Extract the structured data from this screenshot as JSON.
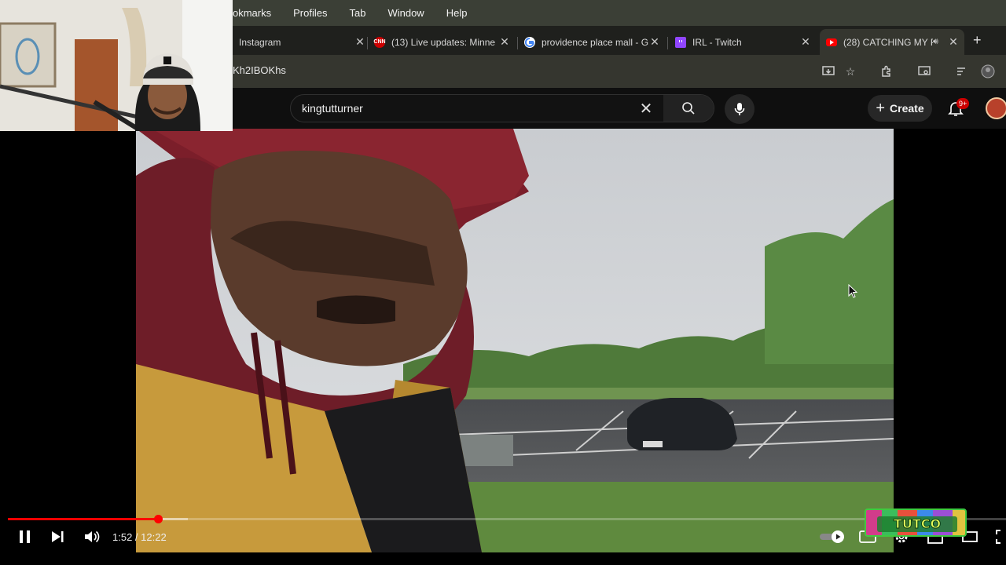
{
  "menubar": {
    "items": [
      "okmarks",
      "Profiles",
      "Tab",
      "Window",
      "Help"
    ]
  },
  "tabs": [
    {
      "title": "Instagram",
      "icon": "instagram-icon"
    },
    {
      "title": "(13) Live updates: Minne",
      "icon": "cnn-icon"
    },
    {
      "title": "providence place mall - G",
      "icon": "google-icon"
    },
    {
      "title": "IRL - Twitch",
      "icon": "twitch-icon"
    },
    {
      "title": "(28) CATCHING MY P",
      "icon": "youtube-icon",
      "active": true
    }
  ],
  "address_bar": {
    "url_fragment": "Kh2IBOKhs"
  },
  "youtube": {
    "search_query": "kingtutturner",
    "create_label": "Create",
    "notification_badge": "9+"
  },
  "player": {
    "current_time": "1:52",
    "duration": "12:22",
    "time_display": "1:52 / 12:22",
    "progress_fraction": 0.151,
    "buffered_fraction": 0.18
  },
  "overlay_logo": {
    "text": "TUTCO"
  },
  "colors": {
    "youtube_red": "#ff0000",
    "background": "#0f0f0f",
    "badge_red": "#cc0000"
  }
}
